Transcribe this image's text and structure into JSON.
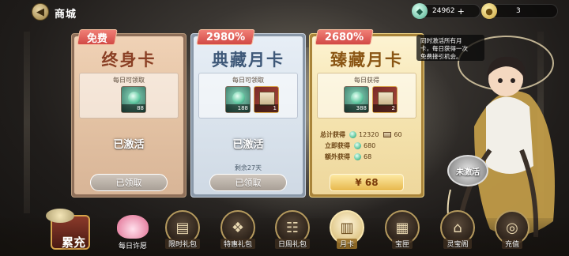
{
  "header": {
    "back_glyph": "◀",
    "title": "商城",
    "currencies": [
      {
        "icon": "jade-icon",
        "value": "24962",
        "plus": "+"
      },
      {
        "icon": "coin-icon",
        "value": "3"
      }
    ]
  },
  "cards": [
    {
      "tag": "免费",
      "title": "终身卡",
      "reward_label": "每日可领取",
      "items": [
        {
          "icon": "jade-icon",
          "count": "88"
        }
      ],
      "status": "已激活",
      "button": "已领取"
    },
    {
      "tag": "2980%",
      "title": "典藏月卡",
      "reward_label": "每日可领取",
      "items": [
        {
          "icon": "jade-icon",
          "count": "188"
        },
        {
          "icon": "book-icon",
          "count": "1"
        }
      ],
      "status": "已激活",
      "remaining": "剩余27天",
      "button": "已领取"
    },
    {
      "tag": "2680%",
      "title": "臻藏月卡",
      "reward_label": "每日获得",
      "items": [
        {
          "icon": "jade-icon",
          "count": "388"
        },
        {
          "icon": "book-icon",
          "count": "2"
        }
      ],
      "stats": [
        {
          "label": "总计获得",
          "jade": "12320",
          "book": "60"
        },
        {
          "label": "立即获得",
          "jade": "680"
        },
        {
          "label": "额外获得",
          "jade": "68"
        }
      ],
      "button": "¥ 68"
    }
  ],
  "tooltip": {
    "lines": [
      "同时激活所有月",
      "卡，每日获得一次",
      "免费接引机会。"
    ]
  },
  "activate_badge": "未激活",
  "bottom_nav": {
    "leichong": "累充",
    "daily": "每日许愿",
    "items": [
      {
        "label": "限时礼包",
        "icon": "gift-icon",
        "glyph": "▤"
      },
      {
        "label": "特惠礼包",
        "icon": "scroll-icon",
        "glyph": "❖"
      },
      {
        "label": "日周礼包",
        "icon": "calendar-icon",
        "glyph": "☷"
      },
      {
        "label": "月卡",
        "icon": "card-icon",
        "glyph": "▥",
        "active": true
      },
      {
        "label": "宝匣",
        "icon": "chest-icon",
        "glyph": "▦"
      },
      {
        "label": "灵宝阁",
        "icon": "pavilion-icon",
        "glyph": "⌂"
      },
      {
        "label": "充值",
        "icon": "coins-icon",
        "glyph": "◎"
      }
    ]
  }
}
